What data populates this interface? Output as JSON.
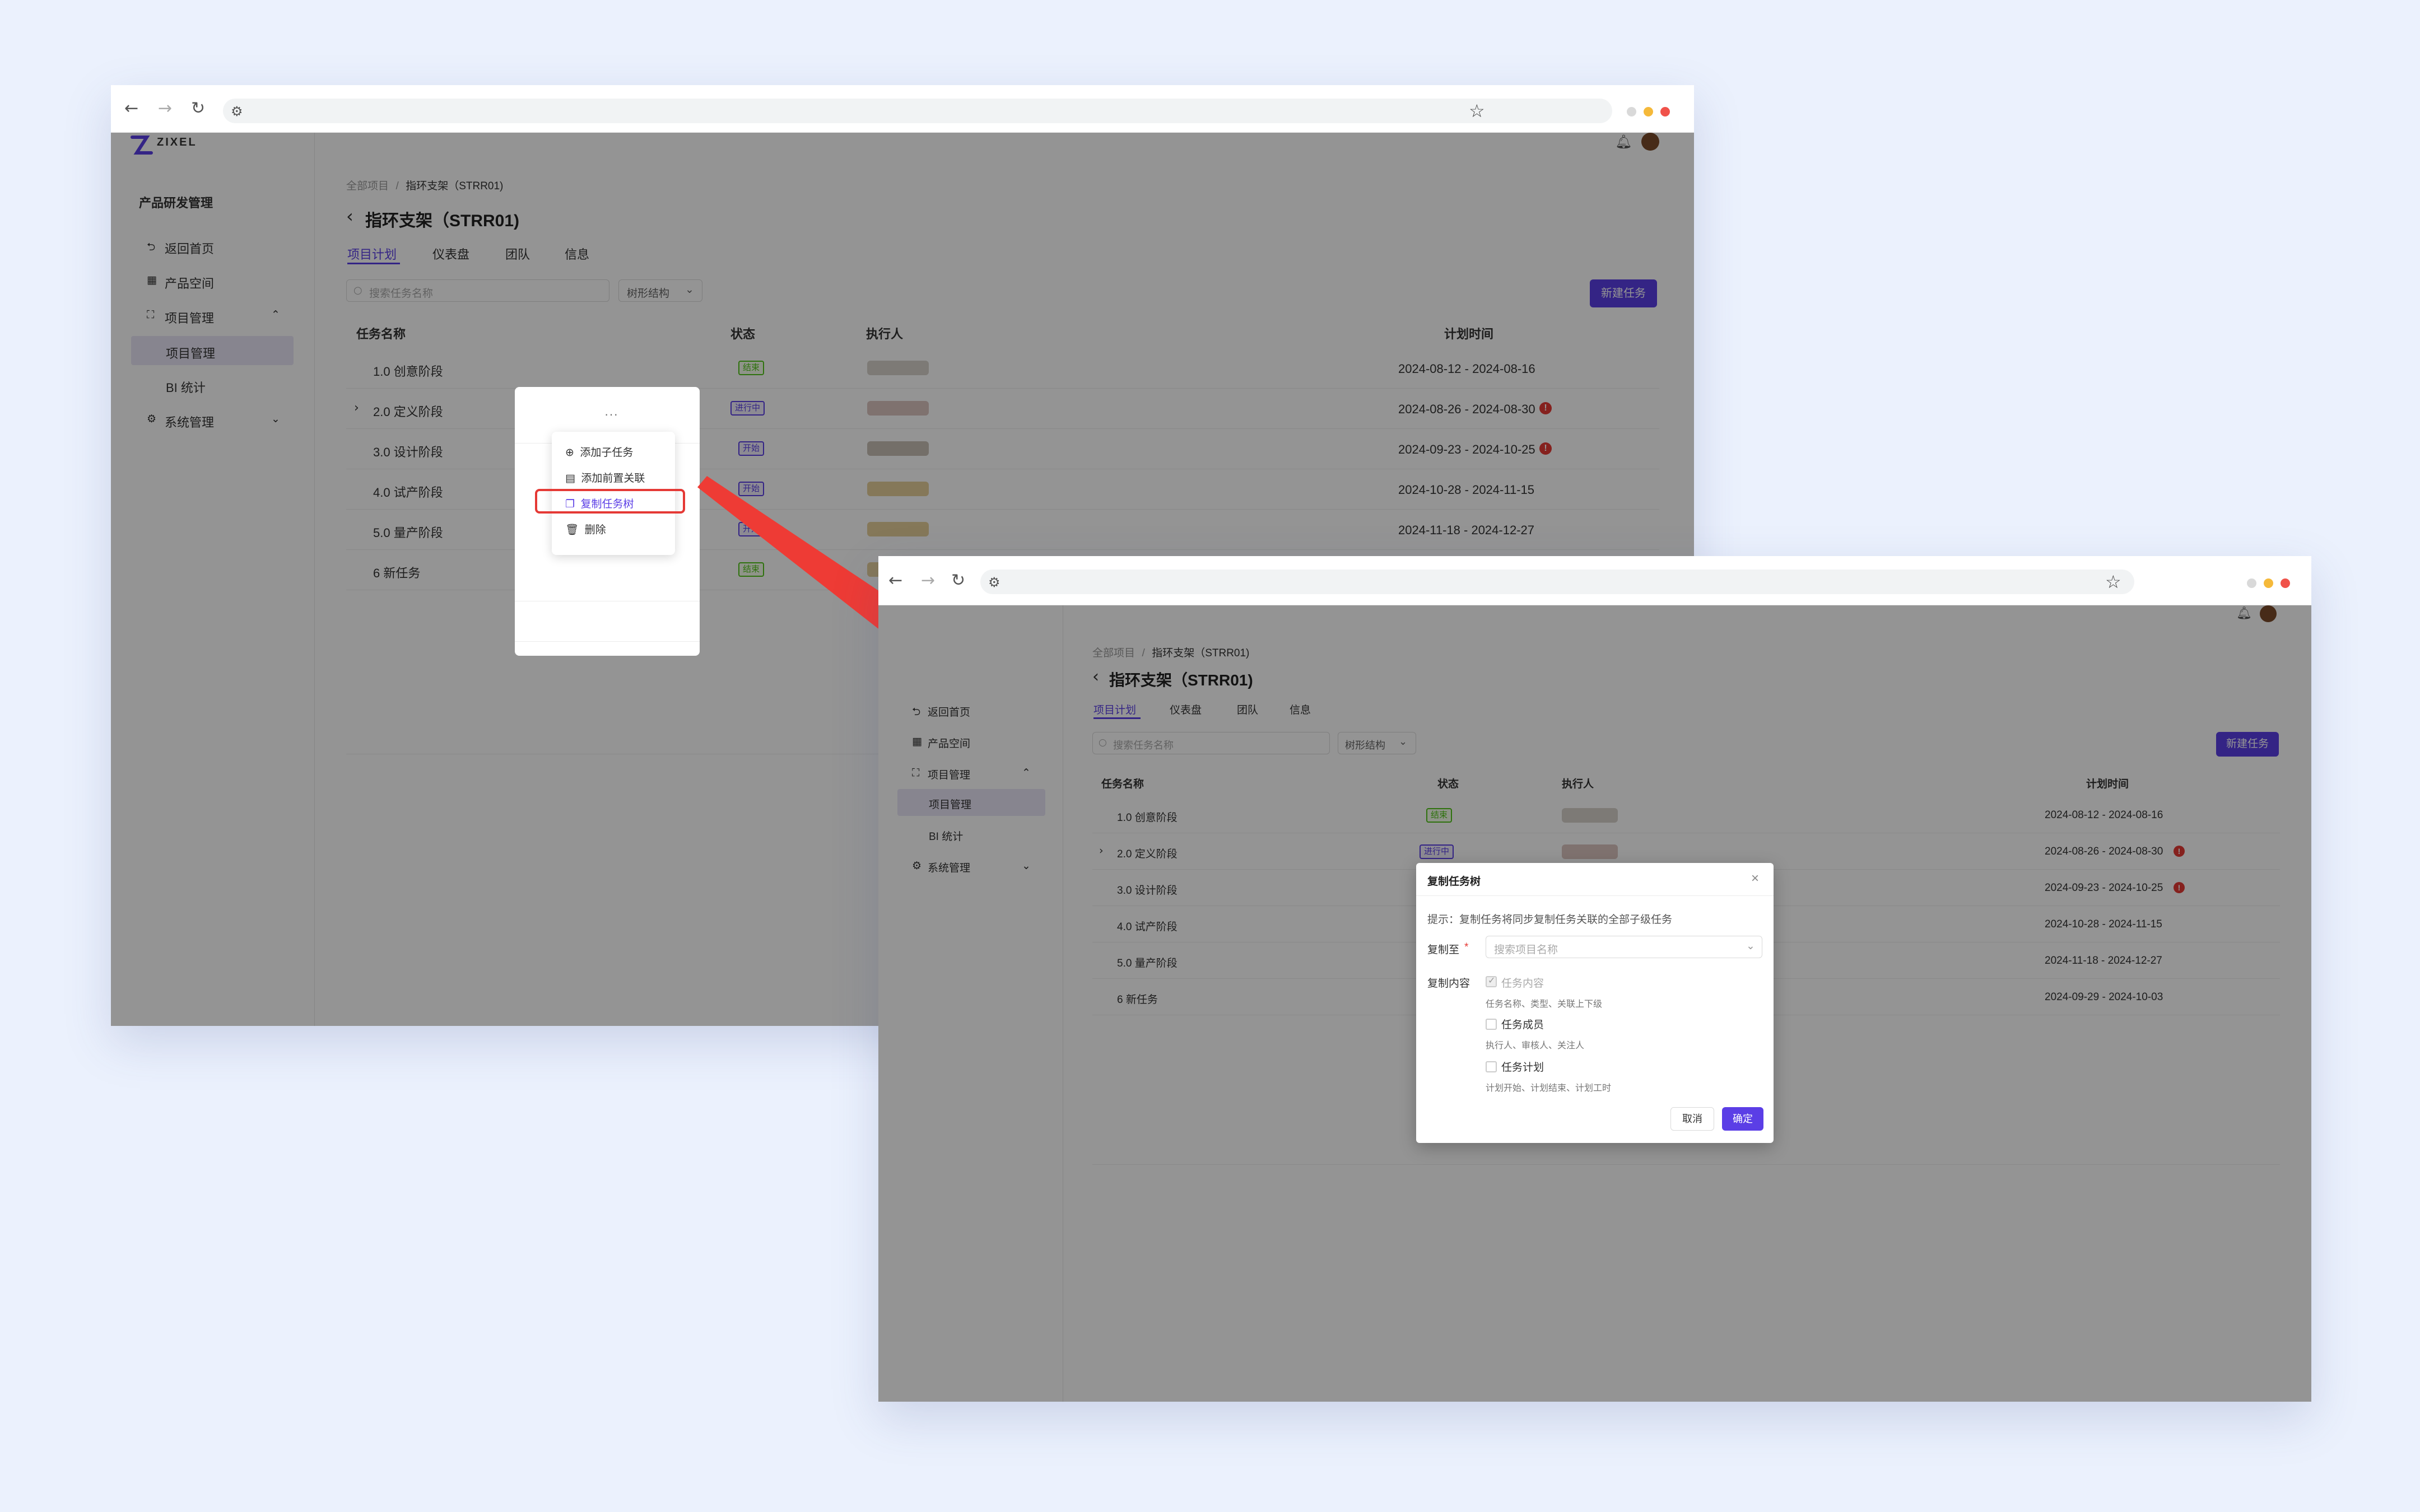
{
  "colors": {
    "background": "#ebf1fd",
    "accent": "#5b3ee6",
    "arrow": "#ee3b35",
    "highlight_box": "#e53935"
  },
  "logo": {
    "text": "ZIXEL"
  },
  "sidebar": {
    "title": "产品研发管理",
    "items": [
      {
        "label": "返回首页",
        "icon": "return-icon"
      },
      {
        "label": "产品空间",
        "icon": "grid-icon"
      },
      {
        "label": "项目管理",
        "icon": "project-icon"
      },
      {
        "label": "项目管理",
        "icon": ""
      },
      {
        "label": "BI 统计",
        "icon": ""
      },
      {
        "label": "系统管理",
        "icon": "settings-icon"
      }
    ]
  },
  "breadcrumb": {
    "root": "全部项目",
    "separator": "/",
    "current": "指环支架（STRR01)"
  },
  "project": {
    "title": "指环支架（STRR01)"
  },
  "tabs": [
    "项目计划",
    "仪表盘",
    "团队",
    "信息"
  ],
  "toolbar": {
    "search_placeholder": "搜索任务名称",
    "view_select": "树形结构",
    "new_task": "新建任务"
  },
  "table": {
    "headers": [
      "任务名称",
      "状态",
      "执行人",
      "计划时间"
    ],
    "rows": [
      {
        "name": "1.0 创意阶段",
        "status": "结束",
        "status_type": "done",
        "date": "2024-08-12 - 2024-08-16",
        "overdue": false,
        "expand": false
      },
      {
        "name": "2.0 定义阶段",
        "status": "进行中",
        "status_type": "doing",
        "date": "2024-08-26 - 2024-08-30",
        "overdue": true,
        "expand": true
      },
      {
        "name": "3.0 设计阶段",
        "status": "开始",
        "status_type": "start",
        "date": "2024-09-23 - 2024-10-25",
        "overdue": true,
        "expand": false
      },
      {
        "name": "4.0 试产阶段",
        "status": "开始",
        "status_type": "start",
        "date": "2024-10-28 - 2024-11-15",
        "overdue": false,
        "expand": false
      },
      {
        "name": "5.0 量产阶段",
        "status": "开始",
        "status_type": "start",
        "date": "2024-11-18 - 2024-12-27",
        "overdue": false,
        "expand": false
      },
      {
        "name": "6 新任务",
        "status": "结束",
        "status_type": "done",
        "date": "2024-09-29 - 2024-10-03",
        "overdue": false,
        "expand": false
      }
    ]
  },
  "context_menu": {
    "trigger": "···",
    "items": [
      {
        "label": "添加子任务",
        "icon": "plus-circle-icon"
      },
      {
        "label": "添加前置关联",
        "icon": "doc-icon"
      },
      {
        "label": "复制任务树",
        "icon": "copy-icon"
      },
      {
        "label": "删除",
        "icon": "trash-icon"
      }
    ]
  },
  "dialog": {
    "title": "复制任务树",
    "close": "×",
    "hint": "提示：复制任务将同步复制任务关联的全部子级任务",
    "copy_to_label": "复制至",
    "required_mark": "*",
    "copy_to_placeholder": "搜索项目名称",
    "content_label": "复制内容",
    "options": [
      {
        "label": "任务内容",
        "desc": "任务名称、类型、关联上下级",
        "checked": true
      },
      {
        "label": "任务成员",
        "desc": "执行人、审核人、关注人",
        "checked": false
      },
      {
        "label": "任务计划",
        "desc": "计划开始、计划结束、计划工时",
        "checked": false
      }
    ],
    "cancel": "取消",
    "confirm": "确定"
  }
}
